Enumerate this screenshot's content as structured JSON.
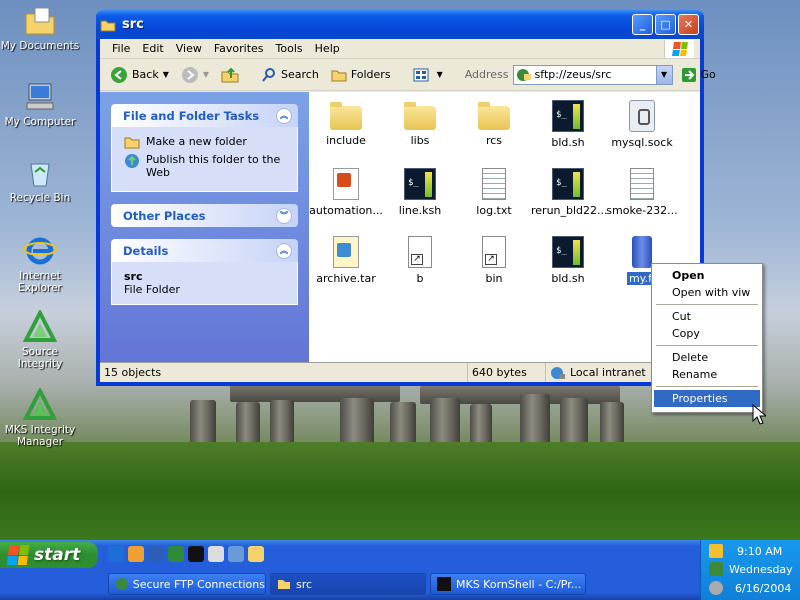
{
  "desktop_icons": [
    {
      "label": "My Documents",
      "icon": "my-documents-icon"
    },
    {
      "label": "My Computer",
      "icon": "my-computer-icon"
    },
    {
      "label": "Recycle Bin",
      "icon": "recycle-bin-icon"
    },
    {
      "label": "Internet Explorer",
      "icon": "internet-explorer-icon"
    },
    {
      "label": "Source Integrity",
      "icon": "source-integrity-icon"
    },
    {
      "label": "MKS Integrity Manager",
      "icon": "mks-integrity-manager-icon"
    }
  ],
  "window": {
    "title": "src"
  },
  "menu": [
    "File",
    "Edit",
    "View",
    "Favorites",
    "Tools",
    "Help"
  ],
  "toolbar": {
    "back": "Back",
    "search": "Search",
    "folders": "Folders",
    "address_label": "Address",
    "address_value": "sftp://zeus/src",
    "go": "Go"
  },
  "tasks": {
    "file_folder_title": "File and Folder Tasks",
    "make_folder": "Make a new folder",
    "publish": "Publish this folder to the Web",
    "other_places_title": "Other Places",
    "details_title": "Details",
    "details_name": "src",
    "details_type": "File Folder"
  },
  "files": [
    {
      "name": "include",
      "type": "folder"
    },
    {
      "name": "libs",
      "type": "folder"
    },
    {
      "name": "rcs",
      "type": "folder"
    },
    {
      "name": "bld.sh",
      "type": "shell"
    },
    {
      "name": "mysql.sock",
      "type": "socket"
    },
    {
      "name": "automation...",
      "type": "html"
    },
    {
      "name": "line.ksh",
      "type": "shell"
    },
    {
      "name": "log.txt",
      "type": "text"
    },
    {
      "name": "rerun_bld22...",
      "type": "shell"
    },
    {
      "name": "smoke-232...",
      "type": "text"
    },
    {
      "name": "archive.tar",
      "type": "archive"
    },
    {
      "name": "b",
      "type": "shortcut"
    },
    {
      "name": "bin",
      "type": "shortcut"
    },
    {
      "name": "bld.sh",
      "type": "shell"
    },
    {
      "name": "my.fi",
      "type": "selected"
    }
  ],
  "status": {
    "count": "15 objects",
    "size": "640 bytes",
    "zone": "Local intranet"
  },
  "context_menu": {
    "open": "Open",
    "open_with": "Open with viw",
    "cut": "Cut",
    "copy": "Copy",
    "delete": "Delete",
    "rename": "Rename",
    "properties": "Properties"
  },
  "taskbar": {
    "start": "start",
    "buttons": [
      "Secure FTP Connections",
      "src",
      "MKS KornShell - C:/Pr..."
    ],
    "time": "9:10 AM",
    "day": "Wednesday",
    "date": "6/16/2004"
  }
}
